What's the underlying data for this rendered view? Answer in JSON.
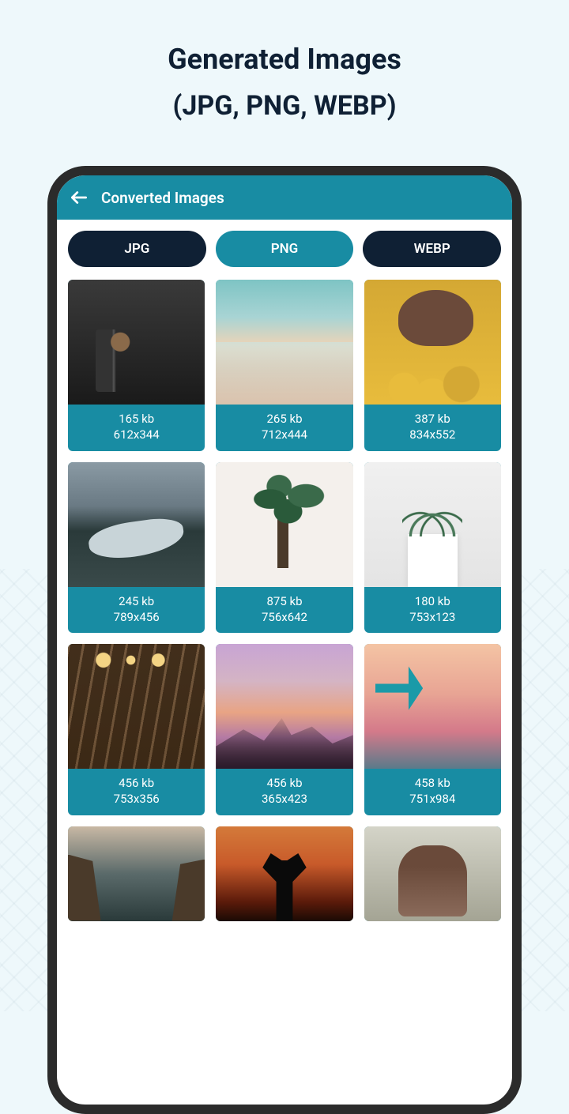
{
  "page": {
    "title": "Generated Images",
    "subtitle": "(JPG, PNG, WEBP)"
  },
  "appbar": {
    "title": "Converted Images"
  },
  "tabs": [
    {
      "label": "JPG",
      "active": false
    },
    {
      "label": "PNG",
      "active": true
    },
    {
      "label": "WEBP",
      "active": false
    }
  ],
  "items": [
    {
      "size": "165 kb",
      "dims": "612x344"
    },
    {
      "size": "265 kb",
      "dims": "712x444"
    },
    {
      "size": "387 kb",
      "dims": "834x552"
    },
    {
      "size": "245 kb",
      "dims": "789x456"
    },
    {
      "size": "875 kb",
      "dims": "756x642"
    },
    {
      "size": "180 kb",
      "dims": "753x123"
    },
    {
      "size": "456 kb",
      "dims": "753x356"
    },
    {
      "size": "456 kb",
      "dims": "365x423"
    },
    {
      "size": "458 kb",
      "dims": "751x984"
    },
    {
      "size": "",
      "dims": ""
    },
    {
      "size": "",
      "dims": ""
    },
    {
      "size": "",
      "dims": ""
    }
  ],
  "colors": {
    "accent": "#188ca3",
    "dark": "#0f2034"
  }
}
